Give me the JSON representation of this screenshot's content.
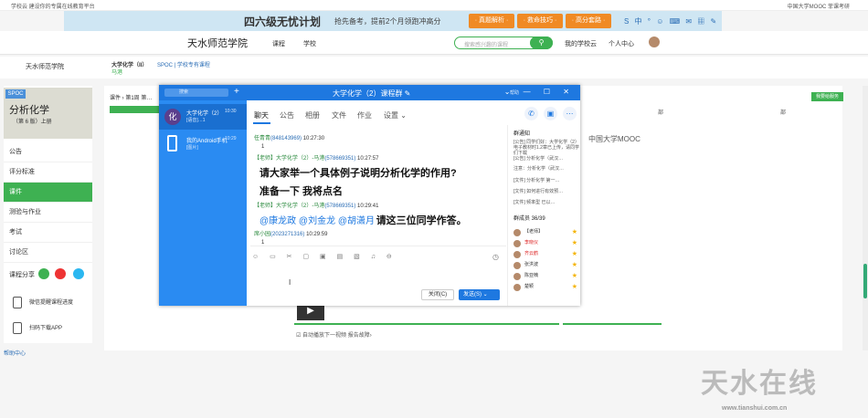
{
  "topbar": {
    "left": "学校云  建设你的专属在线教育平台",
    "right": "中国大学MOOC  菲课考研"
  },
  "banner": {
    "title": "四六级无忧计划",
    "subtitle": "抢先备考，提前2个月领跑冲高分",
    "btn1": "· 真题解析 ·",
    "btn2": "· 救命技巧 ·",
    "btn3": "· 高分套路 ·",
    "icons": "S 中 ° ☺ ⌨ ✉ ▦ ✎"
  },
  "nav": {
    "site": "天水师范学院",
    "course_menu": "课程",
    "school": "学校",
    "search_placeholder": "搜索感兴趣的课程",
    "search_icon": "search-icon",
    "my_cloud": "我的学校云",
    "personal": "个人中心"
  },
  "course": {
    "school_logo": "天水师范学院",
    "title": "大学化学（II）",
    "teacher": "马港",
    "spoc": "SPOC | 学校专有课程"
  },
  "left": {
    "book_title": "分析化学",
    "book_sub": "（第 6 版）上册",
    "spoc_label": "SPOC",
    "menu": [
      "公告",
      "评分标准",
      "课件",
      "测验与作业",
      "考试",
      "讨论区"
    ],
    "share": "课程分享",
    "wechat": "微信提醒课程进度",
    "app": "扫码下载APP",
    "help": "帮助中心"
  },
  "main": {
    "breadcrumb": "课件 › 第1周 第…",
    "feedback": "我要给服务",
    "col1": "部",
    "col2": "部",
    "col3": "部",
    "mooc": "中国大学MOOC",
    "autoplay": "☑ 自动播放下一视频  报告故障›"
  },
  "qq": {
    "window_title": "大学化学（2）课程群 ✎",
    "search": "搜索",
    "plus": "+",
    "menu_label": "帮助",
    "controls": "⌄ — ☐ ✕",
    "convs": [
      {
        "name": "大学化学（2）",
        "sub": "[语音]…1",
        "time": "10:30",
        "avatar": "化"
      },
      {
        "name": "我的Android手机",
        "sub": "[图片]",
        "time": "10:29"
      }
    ],
    "tabs": [
      "聊天",
      "公告",
      "相册",
      "文件",
      "作业",
      "设置 ⌄"
    ],
    "messages": [
      {
        "meta": "任青青",
        "qq": "(848143969)",
        "time": "10:27:30",
        "text": "1"
      },
      {
        "meta": "【老师】大学化学（2）-马港",
        "qq": "(578669351)",
        "time": "10:27:57",
        "big1": "请大家举一个具体例子说明分析化学的作用?",
        "big2": "准备一下 我将点名"
      },
      {
        "meta": "【老师】大学化学（2）-马港",
        "qq": "(578669351)",
        "time": "10:29:41",
        "ats": "@康龙政 @刘金龙 @胡潇月",
        "tail": "请这三位同学作答。"
      },
      {
        "meta": "席小园",
        "qq": "(2023271316)",
        "time": "10:29:59",
        "text": "1"
      }
    ],
    "toolbar": "☺ ▭ ✂ ▢ ▣ ▤ ▧ ♫ ⊖",
    "close": "关闭(C)",
    "send": "发送(S) ⌄",
    "notice_title": "群通知",
    "notices": [
      "[公告] 同学们好：大学化学（2）电子教材时1.2章已上传，请同学们下载",
      "[公告] 分析化学（武汉…",
      "注意：分析化学（武汉…",
      "[文件] 分析化学 第一…",
      "[文件] 如何进行有效预…",
      "[文件] 频率型 已以…"
    ],
    "members_title": "群成员 36/39",
    "members": [
      {
        "name": "【老师】",
        "color": "#333"
      },
      {
        "name": "李晓仪",
        "color": "#d22"
      },
      {
        "name": "齐云鹤",
        "color": "#d22"
      },
      {
        "name": "张洪波",
        "color": "#333"
      },
      {
        "name": "陈亚楠",
        "color": "#333"
      },
      {
        "name": "楚颖",
        "color": "#333"
      }
    ]
  },
  "watermark": {
    "text": "天水在线",
    "url": "www.tianshui.com.cn"
  }
}
